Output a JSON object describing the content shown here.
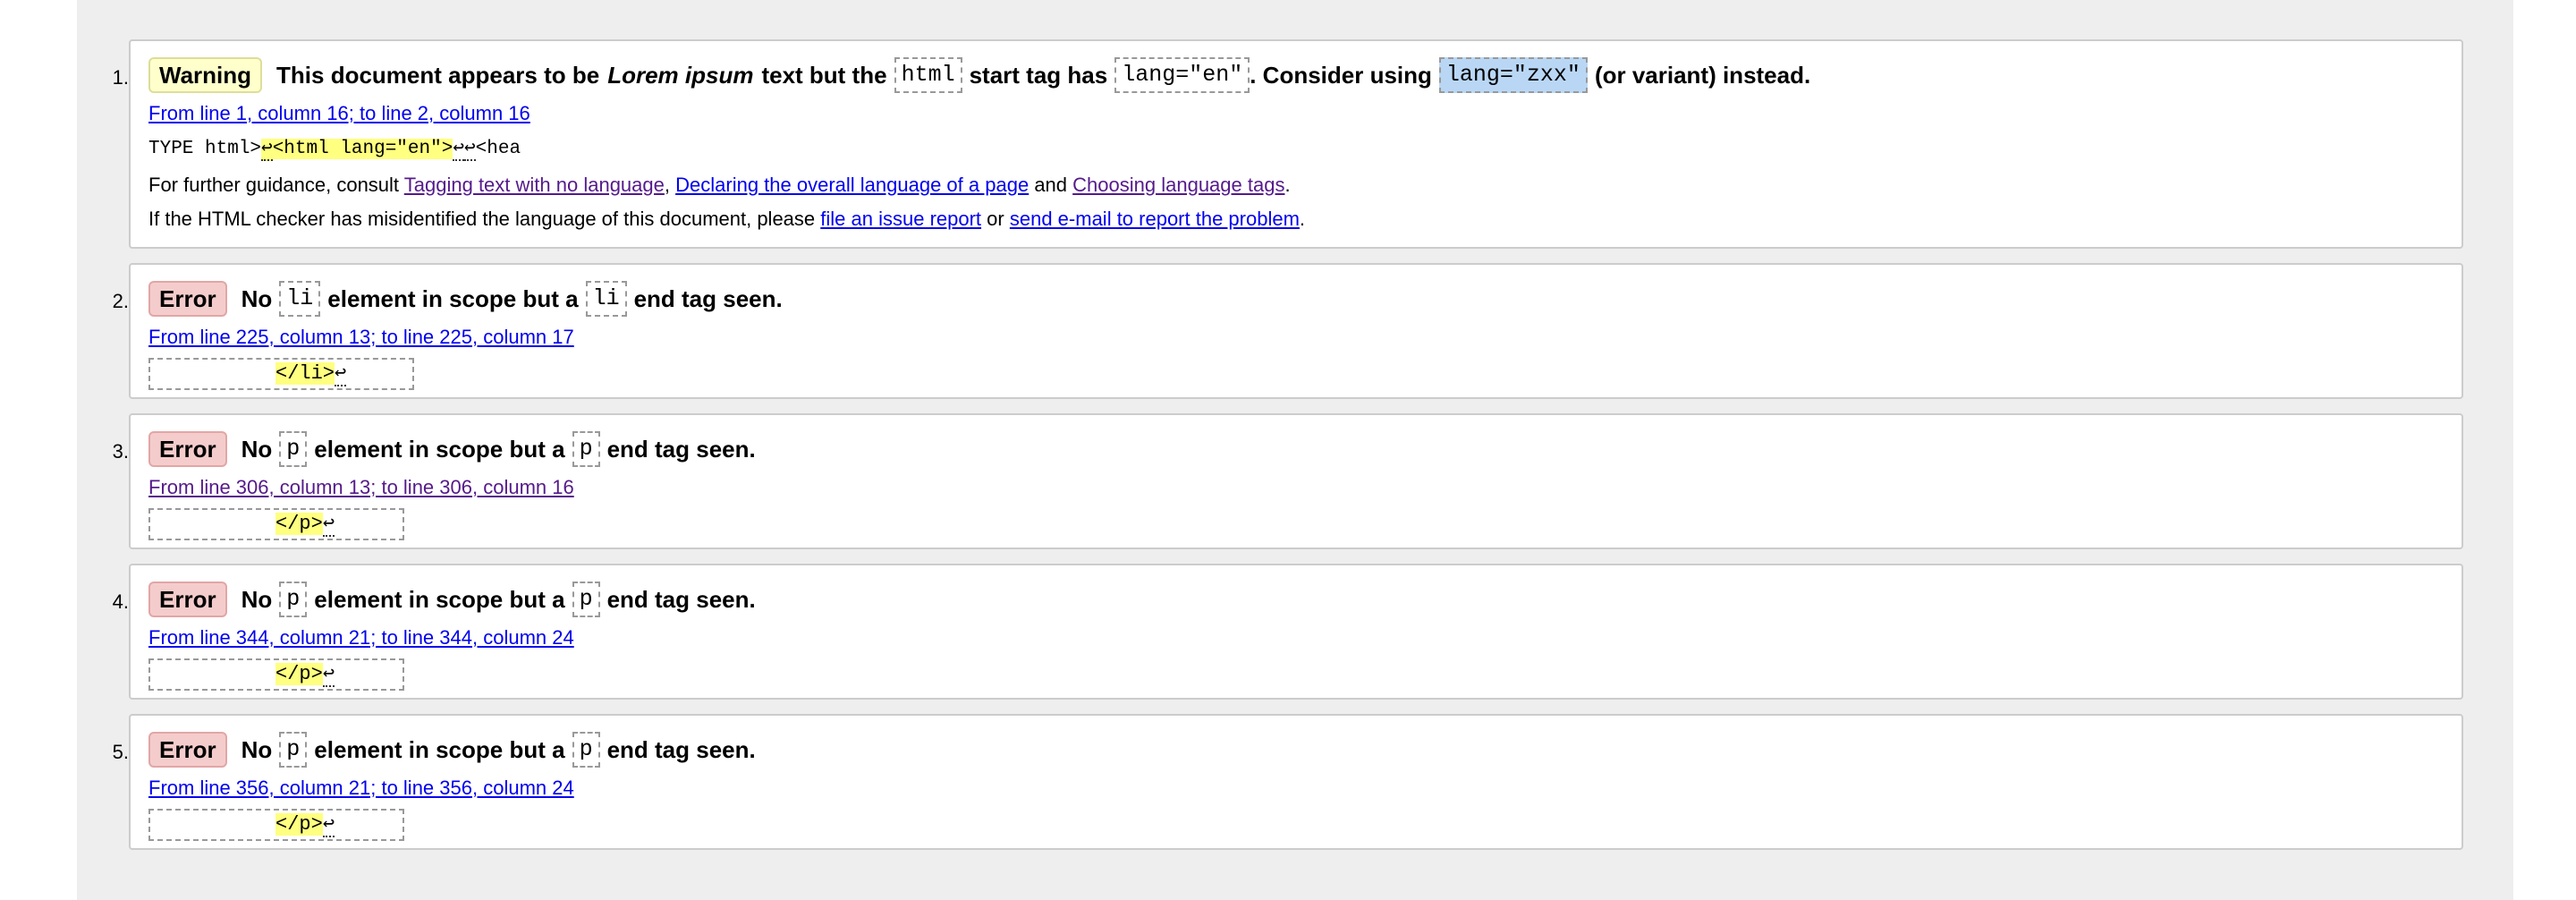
{
  "messages": [
    {
      "num": "1.",
      "type": "Warning",
      "title_parts": {
        "t1": "This document appears to be",
        "em": "Lorem ipsum",
        "t2": "text but the",
        "code1": "html",
        "t3": "start tag has",
        "code2": "lang=\"en\"",
        "t4": ". Consider using",
        "code3": "lang=\"zxx\"",
        "t5": "(or variant) instead."
      },
      "location": "From line 1, column 16; to line 2, column 16",
      "extract": {
        "before": "TYPE html>",
        "lf1": "↩",
        "mark": "<html lang=\"en\">",
        "lf2": "↩",
        "lf3": "↩",
        "after": "<hea"
      },
      "guidance": {
        "prefix": "For further guidance, consult",
        "link1": "Tagging text with no language",
        "sep": ",",
        "link2": "Declaring the overall language of a page",
        "and": "and",
        "link3": "Choosing language tags",
        "end": "."
      },
      "report": {
        "prefix": "If the HTML checker has misidentified the language of this document, please",
        "link1": "file an issue report",
        "or": "or",
        "link2": "send e-mail to report the problem",
        "end": "."
      }
    },
    {
      "num": "2.",
      "type": "Error",
      "no": "No",
      "code1": "li",
      "mid": "element in scope but a",
      "code2": "li",
      "end": "end tag seen.",
      "location": "From line 225, column 13; to line 225, column 17",
      "extract_mark": "</li>",
      "extract_lf": "↩"
    },
    {
      "num": "3.",
      "type": "Error",
      "no": "No",
      "code1": "p",
      "mid": "element in scope but a",
      "code2": "p",
      "end": "end tag seen.",
      "location": "From line 306, column 13; to line 306, column 16",
      "extract_mark": "</p>",
      "extract_lf": "↩"
    },
    {
      "num": "4.",
      "type": "Error",
      "no": "No",
      "code1": "p",
      "mid": "element in scope but a",
      "code2": "p",
      "end": "end tag seen.",
      "location": "From line 344, column 21; to line 344, column 24",
      "extract_mark": "</p>",
      "extract_lf": "↩"
    },
    {
      "num": "5.",
      "type": "Error",
      "no": "No",
      "code1": "p",
      "mid": "element in scope but a",
      "code2": "p",
      "end": "end tag seen.",
      "location": "From line 356, column 21; to line 356, column 24",
      "extract_mark": "</p>",
      "extract_lf": "↩"
    }
  ],
  "colors": {
    "panel_bg": "#eeeeee",
    "warning_bg": "#ffffcc",
    "error_bg": "#f5cccc",
    "link": "#0000ee",
    "visited": "#551a8b",
    "highlight": "#ffff80",
    "selection": "#b9d7f5"
  }
}
